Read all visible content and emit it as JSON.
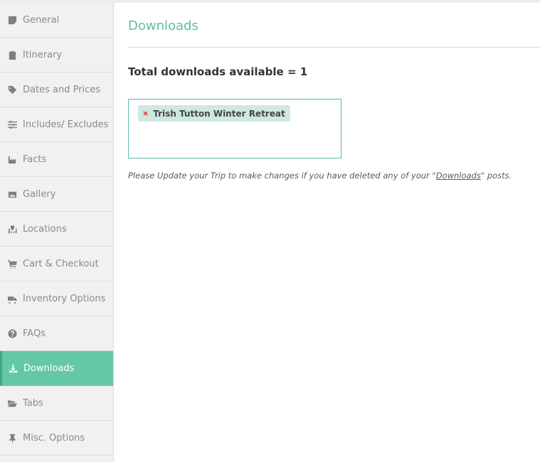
{
  "sidebar": {
    "items": [
      {
        "label": "General",
        "icon": "sticky-note-icon",
        "active": false
      },
      {
        "label": "Itinerary",
        "icon": "clipboard-icon",
        "active": false
      },
      {
        "label": "Dates and Prices",
        "icon": "tag-icon",
        "active": false
      },
      {
        "label": "Includes/ Excludes",
        "icon": "sliders-icon",
        "active": false
      },
      {
        "label": "Facts",
        "icon": "industry-icon",
        "active": false
      },
      {
        "label": "Gallery",
        "icon": "images-icon",
        "active": false
      },
      {
        "label": "Locations",
        "icon": "map-marked-icon",
        "active": false
      },
      {
        "label": "Cart & Checkout",
        "icon": "cart-icon",
        "active": false
      },
      {
        "label": "Inventory Options",
        "icon": "truck-icon",
        "active": false
      },
      {
        "label": "FAQs",
        "icon": "question-circle-icon",
        "active": false
      },
      {
        "label": "Downloads",
        "icon": "download-icon",
        "active": true
      },
      {
        "label": "Tabs",
        "icon": "folder-open-icon",
        "active": false
      },
      {
        "label": "Misc. Options",
        "icon": "thumbtack-icon",
        "active": false
      }
    ]
  },
  "main": {
    "title": "Downloads",
    "total_label": "Total downloads available = 1",
    "selected_downloads": [
      {
        "label": "Trish Tutton Winter Retreat",
        "remove_symbol": "×"
      }
    ],
    "note_prefix": "Please Update your Trip to make changes if you have deleted any of your \"",
    "note_link": "Downloads",
    "note_suffix": "\" posts."
  },
  "colors": {
    "accent": "#65c8a4",
    "title": "#5fbf96",
    "tag_bg": "#cde9e1",
    "remove": "#d9262b"
  }
}
